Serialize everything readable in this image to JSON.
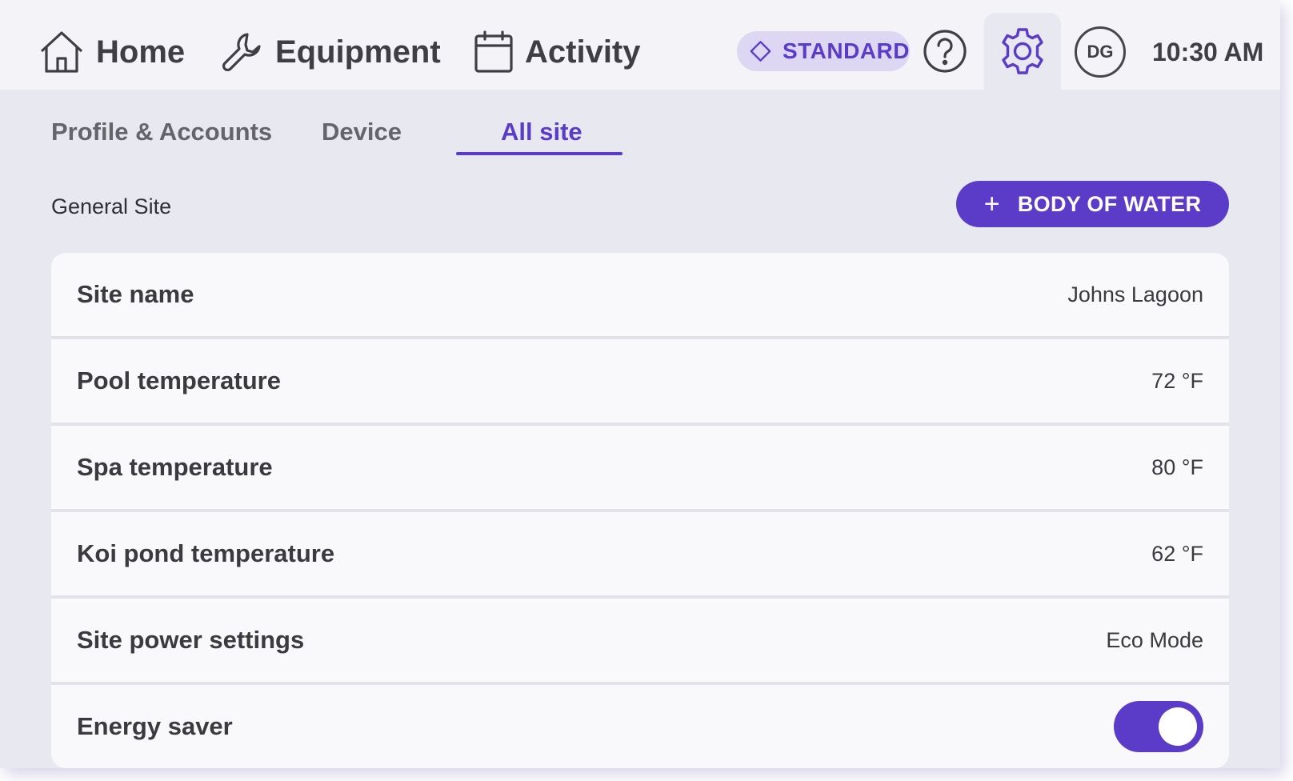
{
  "nav": {
    "home": {
      "label": "Home",
      "icon": "home-icon"
    },
    "equipment": {
      "label": "Equipment",
      "icon": "wrench-icon"
    },
    "activity": {
      "label": "Activity",
      "icon": "calendar-icon"
    }
  },
  "header": {
    "plan_badge": {
      "label": "STANDARD",
      "icon": "diamond-icon"
    },
    "help_icon": "help-icon",
    "settings_icon": "gear-icon",
    "avatar_initials": "DG",
    "time": "10:30 AM"
  },
  "tabs": [
    {
      "label": "Profile & Accounts",
      "active": false
    },
    {
      "label": "Device",
      "active": false
    },
    {
      "label": "All site",
      "active": true
    }
  ],
  "section": {
    "title": "General Site",
    "add_button": {
      "icon": "+",
      "label": "BODY OF WATER"
    }
  },
  "settings": [
    {
      "label": "Site name",
      "value": "Johns Lagoon"
    },
    {
      "label": "Pool temperature",
      "value": "72 °F"
    },
    {
      "label": "Spa temperature",
      "value": "80 °F"
    },
    {
      "label": "Koi pond temperature",
      "value": "62 °F"
    },
    {
      "label": "Site power settings",
      "value": "Eco Mode"
    },
    {
      "label": "Energy saver",
      "toggle": true
    }
  ],
  "colors": {
    "accent": "#5a3cc8",
    "badge_bg": "#ddd7f4",
    "background": "#e8e8f1",
    "topbar": "#f3f3f8",
    "row_bg": "#f9f9fb"
  }
}
